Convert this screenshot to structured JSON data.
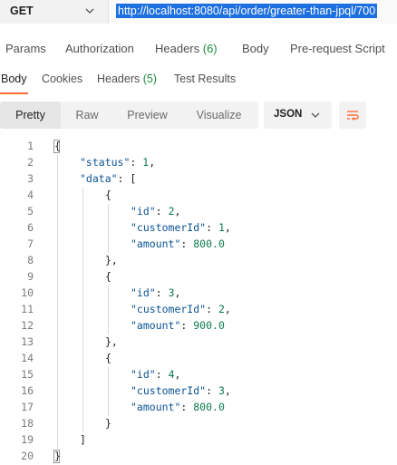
{
  "request": {
    "method": "GET",
    "url": "http://localhost:8080/api/order/greater-than-jpql/700"
  },
  "request_tabs": [
    {
      "label": "Params",
      "count": ""
    },
    {
      "label": "Authorization",
      "count": ""
    },
    {
      "label": "Headers ",
      "count": "(6)"
    },
    {
      "label": "Body",
      "count": ""
    },
    {
      "label": "Pre-request Script",
      "count": ""
    }
  ],
  "response_tabs": [
    {
      "label": "Body",
      "count": ""
    },
    {
      "label": "Cookies",
      "count": ""
    },
    {
      "label": "Headers ",
      "count": "(5)"
    },
    {
      "label": "Test Results",
      "count": ""
    }
  ],
  "format": {
    "buttons": [
      "Pretty",
      "Raw",
      "Preview",
      "Visualize"
    ],
    "active": "Pretty",
    "language": "JSON"
  },
  "code_lines": [
    {
      "n": "1",
      "indent": 0,
      "parts": [
        [
          "p",
          "{"
        ]
      ]
    },
    {
      "n": "2",
      "indent": 1,
      "parts": [
        [
          "k",
          "\"status\""
        ],
        [
          "p",
          ": "
        ],
        [
          "n",
          "1"
        ],
        [
          "p",
          ","
        ]
      ]
    },
    {
      "n": "3",
      "indent": 1,
      "parts": [
        [
          "k",
          "\"data\""
        ],
        [
          "p",
          ": ["
        ]
      ]
    },
    {
      "n": "4",
      "indent": 2,
      "parts": [
        [
          "p",
          "{"
        ]
      ]
    },
    {
      "n": "5",
      "indent": 3,
      "parts": [
        [
          "k",
          "\"id\""
        ],
        [
          "p",
          ": "
        ],
        [
          "n",
          "2"
        ],
        [
          "p",
          ","
        ]
      ]
    },
    {
      "n": "6",
      "indent": 3,
      "parts": [
        [
          "k",
          "\"customerId\""
        ],
        [
          "p",
          ": "
        ],
        [
          "n",
          "1"
        ],
        [
          "p",
          ","
        ]
      ]
    },
    {
      "n": "7",
      "indent": 3,
      "parts": [
        [
          "k",
          "\"amount\""
        ],
        [
          "p",
          ": "
        ],
        [
          "n",
          "800.0"
        ]
      ]
    },
    {
      "n": "8",
      "indent": 2,
      "parts": [
        [
          "p",
          "},"
        ]
      ]
    },
    {
      "n": "9",
      "indent": 2,
      "parts": [
        [
          "p",
          "{"
        ]
      ]
    },
    {
      "n": "10",
      "indent": 3,
      "parts": [
        [
          "k",
          "\"id\""
        ],
        [
          "p",
          ": "
        ],
        [
          "n",
          "3"
        ],
        [
          "p",
          ","
        ]
      ]
    },
    {
      "n": "11",
      "indent": 3,
      "parts": [
        [
          "k",
          "\"customerId\""
        ],
        [
          "p",
          ": "
        ],
        [
          "n",
          "2"
        ],
        [
          "p",
          ","
        ]
      ]
    },
    {
      "n": "12",
      "indent": 3,
      "parts": [
        [
          "k",
          "\"amount\""
        ],
        [
          "p",
          ": "
        ],
        [
          "n",
          "900.0"
        ]
      ]
    },
    {
      "n": "13",
      "indent": 2,
      "parts": [
        [
          "p",
          "},"
        ]
      ]
    },
    {
      "n": "14",
      "indent": 2,
      "parts": [
        [
          "p",
          "{"
        ]
      ]
    },
    {
      "n": "15",
      "indent": 3,
      "parts": [
        [
          "k",
          "\"id\""
        ],
        [
          "p",
          ": "
        ],
        [
          "n",
          "4"
        ],
        [
          "p",
          ","
        ]
      ]
    },
    {
      "n": "16",
      "indent": 3,
      "parts": [
        [
          "k",
          "\"customerId\""
        ],
        [
          "p",
          ": "
        ],
        [
          "n",
          "3"
        ],
        [
          "p",
          ","
        ]
      ]
    },
    {
      "n": "17",
      "indent": 3,
      "parts": [
        [
          "k",
          "\"amount\""
        ],
        [
          "p",
          ": "
        ],
        [
          "n",
          "800.0"
        ]
      ]
    },
    {
      "n": "18",
      "indent": 2,
      "parts": [
        [
          "p",
          "}"
        ]
      ]
    },
    {
      "n": "19",
      "indent": 1,
      "parts": [
        [
          "p",
          "]"
        ]
      ]
    },
    {
      "n": "20",
      "indent": 0,
      "parts": [
        [
          "p",
          "}"
        ]
      ]
    }
  ],
  "icons": {
    "method_dropdown": "chevron-down-icon",
    "language_dropdown": "chevron-down-icon",
    "wrap": "text-wrap-icon"
  },
  "colors": {
    "accent": "#ff6c37",
    "url_selection": "#1e6fe0",
    "count_green": "#1f8a3e",
    "json_key": "#0b5394",
    "json_number": "#0b7a4a"
  }
}
